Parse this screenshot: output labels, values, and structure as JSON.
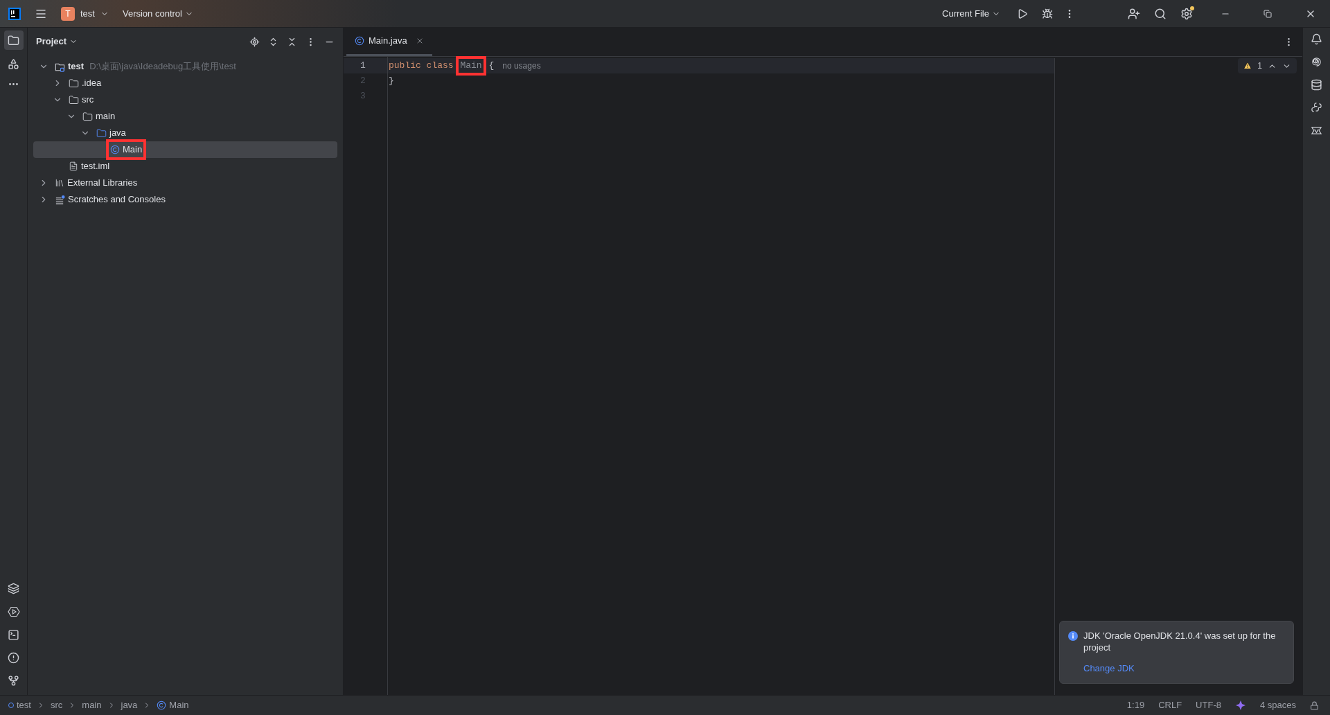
{
  "title_bar": {
    "project_initial": "T",
    "project": "test",
    "vcs": "Version control",
    "run_config": "Current File",
    "settings_badge": true
  },
  "project_panel": {
    "title": "Project",
    "tree": [
      {
        "label": "test",
        "path": "D:\\桌面\\java\\Ideadebug工具使用\\test",
        "kind": "module",
        "expanded": true,
        "selected": false,
        "highlighted": false,
        "children": [
          {
            "label": ".idea",
            "kind": "folder",
            "expanded": false,
            "selected": false,
            "highlighted": false
          },
          {
            "label": "src",
            "kind": "folder",
            "expanded": true,
            "selected": false,
            "highlighted": false,
            "children": [
              {
                "label": "main",
                "kind": "folder",
                "expanded": true,
                "selected": false,
                "highlighted": false,
                "children": [
                  {
                    "label": "java",
                    "kind": "source",
                    "expanded": true,
                    "selected": false,
                    "highlighted": false,
                    "children": [
                      {
                        "label": "Main",
                        "kind": "class",
                        "selected": true,
                        "highlighted": true
                      }
                    ]
                  }
                ]
              }
            ]
          },
          {
            "label": "test.iml",
            "kind": "file",
            "selected": false,
            "highlighted": false
          }
        ]
      },
      {
        "label": "External Libraries",
        "kind": "library",
        "expanded": false,
        "selected": false,
        "highlighted": false
      },
      {
        "label": "Scratches and Consoles",
        "kind": "scratches",
        "expanded": false,
        "selected": false,
        "highlighted": false
      }
    ]
  },
  "editor": {
    "tabs": [
      {
        "label": "Main.java",
        "selected": true
      }
    ],
    "lines": [
      {
        "number": "1",
        "current": true,
        "tokens": [
          {
            "text": "public ",
            "kind": "keyword",
            "highlighted": false
          },
          {
            "text": "class ",
            "kind": "keyword",
            "highlighted": false
          },
          {
            "text": "Main",
            "kind": "unused",
            "highlighted": true
          },
          {
            "text": " {",
            "kind": "plain",
            "highlighted": false
          }
        ],
        "hint": "no usages"
      },
      {
        "number": "2",
        "current": false,
        "tokens": [
          {
            "text": "}",
            "kind": "plain",
            "highlighted": false
          }
        ]
      },
      {
        "number": "3",
        "current": false
      }
    ],
    "warnings": "1"
  },
  "notification": {
    "message": "JDK 'Oracle OpenJDK 21.0.4' was set up for the project",
    "action": "Change JDK"
  },
  "status_bar": {
    "breadcrumbs": [
      {
        "label": "test",
        "kind": "module"
      },
      {
        "label": "src",
        "kind": "folder"
      },
      {
        "label": "main",
        "kind": "folder"
      },
      {
        "label": "java",
        "kind": "folder"
      },
      {
        "label": "Main",
        "kind": "class"
      }
    ],
    "items": [
      "1:19",
      "CRLF",
      "UTF-8"
    ],
    "indent": "4 spaces"
  }
}
